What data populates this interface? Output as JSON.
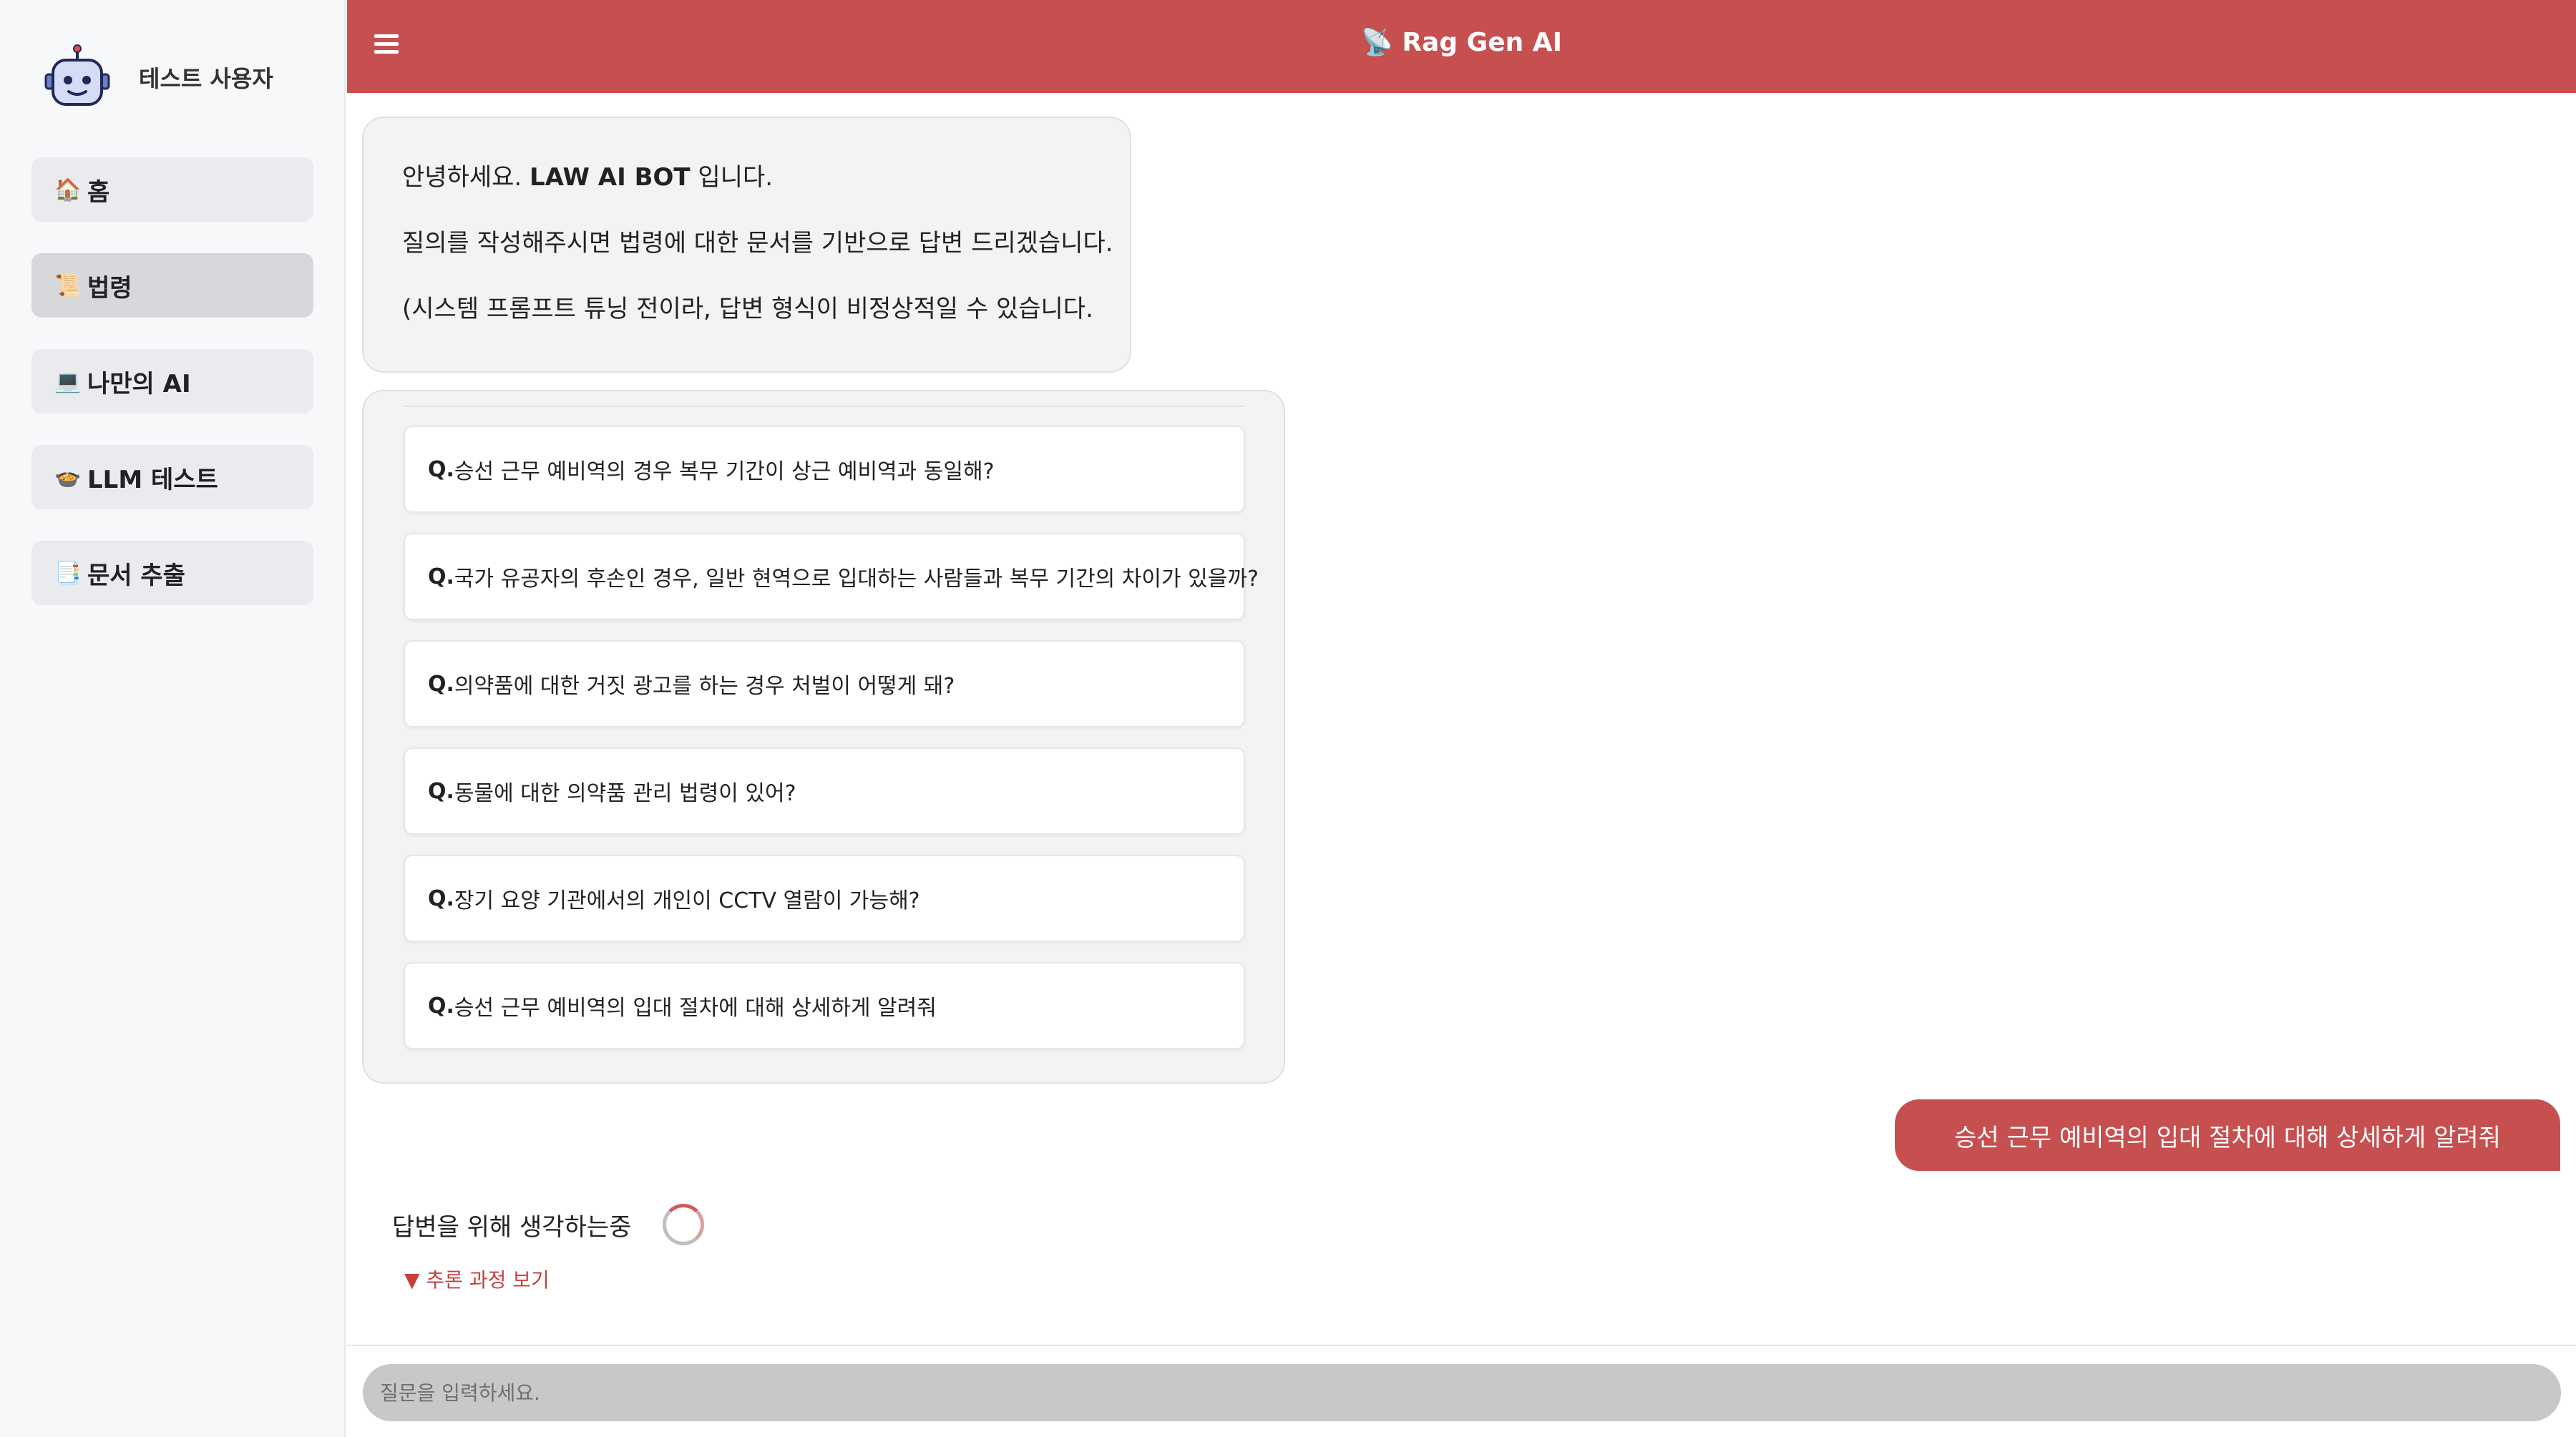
{
  "sidebar": {
    "username": "테스트 사용자",
    "items": [
      {
        "icon": "🏠",
        "label": "홈"
      },
      {
        "icon": "📜",
        "label": "법령"
      },
      {
        "icon": "💻",
        "label": "나만의 AI"
      },
      {
        "icon": "🍲",
        "label": "LLM 테스트"
      },
      {
        "icon": "📑",
        "label": "문서 추출"
      }
    ],
    "active_item": "법령"
  },
  "header": {
    "title": "📡 Rag Gen AI"
  },
  "chat": {
    "intro": {
      "greeting_prefix": "안녕하세요. ",
      "bot_name": "LAW AI BOT",
      "greeting_suffix": " 입니다.",
      "line2": "질의를 작성해주시면 법령에 대한 문서를 기반으로 답변 드리겠습니다.",
      "line3": "(시스템 프롬프트 튜닝 전이라, 답변 형식이 비정상적일 수 있습니다."
    },
    "suggestions": {
      "prefix": "Q.",
      "items": [
        "승선 근무 예비역의 경우 복무 기간이 상근 예비역과 동일해?",
        "국가 유공자의 후손인 경우, 일반 현역으로 입대하는 사람들과 복무 기간의 차이가 있을까?",
        "의약품에 대한 거짓 광고를 하는 경우 처벌이 어떻게 돼?",
        "동물에 대한 의약품 관리 법령이 있어?",
        "장기 요양 기관에서의 개인이 CCTV 열람이 가능해?",
        "승선 근무 예비역의 입대 절차에 대해 상세하게 알려줘"
      ]
    },
    "user_message": "승선 근무 예비역의 입대 절차에 대해 상세하게 알려줘",
    "thinking_text": "답변을 위해 생각하는중",
    "reasoning_toggle": "▼ 추론 과정 보기"
  },
  "input": {
    "placeholder": "질문을 입력하세요."
  },
  "colors": {
    "accent": "#c65050",
    "sidebar_bg": "#f7f8fa",
    "bubble_bg": "#f3f3f3"
  }
}
